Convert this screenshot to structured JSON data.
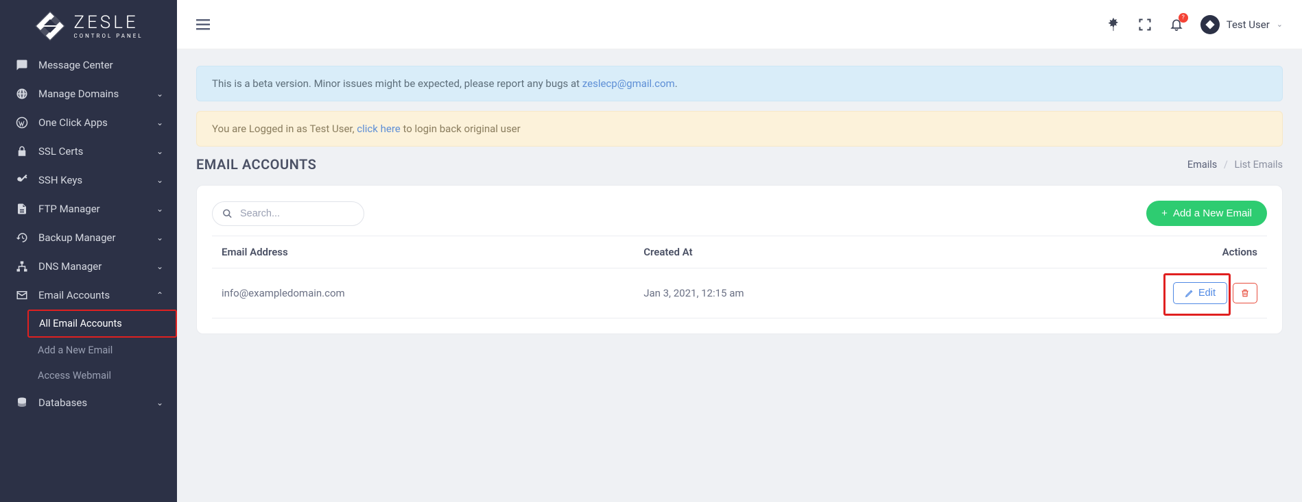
{
  "brand": {
    "name": "ZESLE",
    "subtitle": "CONTROL PANEL"
  },
  "sidebar": {
    "items": [
      {
        "label": "Message Center",
        "icon": "chat"
      },
      {
        "label": "Manage Domains",
        "icon": "globe",
        "expandable": true
      },
      {
        "label": "One Click Apps",
        "icon": "wordpress",
        "expandable": true
      },
      {
        "label": "SSL Certs",
        "icon": "lock",
        "expandable": true
      },
      {
        "label": "SSH Keys",
        "icon": "key",
        "expandable": true
      },
      {
        "label": "FTP Manager",
        "icon": "file",
        "expandable": true
      },
      {
        "label": "Backup Manager",
        "icon": "history",
        "expandable": true
      },
      {
        "label": "DNS Manager",
        "icon": "sitemap",
        "expandable": true
      },
      {
        "label": "Email Accounts",
        "icon": "envelope",
        "expandable": true,
        "expanded": true
      },
      {
        "label": "Databases",
        "icon": "database",
        "expandable": true
      }
    ],
    "email_sub": [
      {
        "label": "All Email Accounts",
        "active": true
      },
      {
        "label": "Add a New Email"
      },
      {
        "label": "Access Webmail"
      }
    ]
  },
  "topbar": {
    "notif_badge": "?",
    "user_name": "Test User"
  },
  "alerts": {
    "beta_pre": "This is a beta version. Minor issues might be expected, please report any bugs at ",
    "beta_email": "zeslecp@gmail.com",
    "beta_post": ".",
    "login_pre": "You are Logged in as Test User, ",
    "login_link": "click here",
    "login_post": " to login back original user"
  },
  "page": {
    "title": "EMAIL ACCOUNTS",
    "breadcrumb_root": "Emails",
    "breadcrumb_current": "List Emails",
    "search_placeholder": "Search...",
    "add_button": "Add a New Email"
  },
  "table": {
    "columns": [
      "Email Address",
      "Created At",
      "Actions"
    ],
    "rows": [
      {
        "email": "info@exampledomain.com",
        "created_at": "Jan 3, 2021, 12:15 am",
        "edit_label": "Edit"
      }
    ]
  }
}
